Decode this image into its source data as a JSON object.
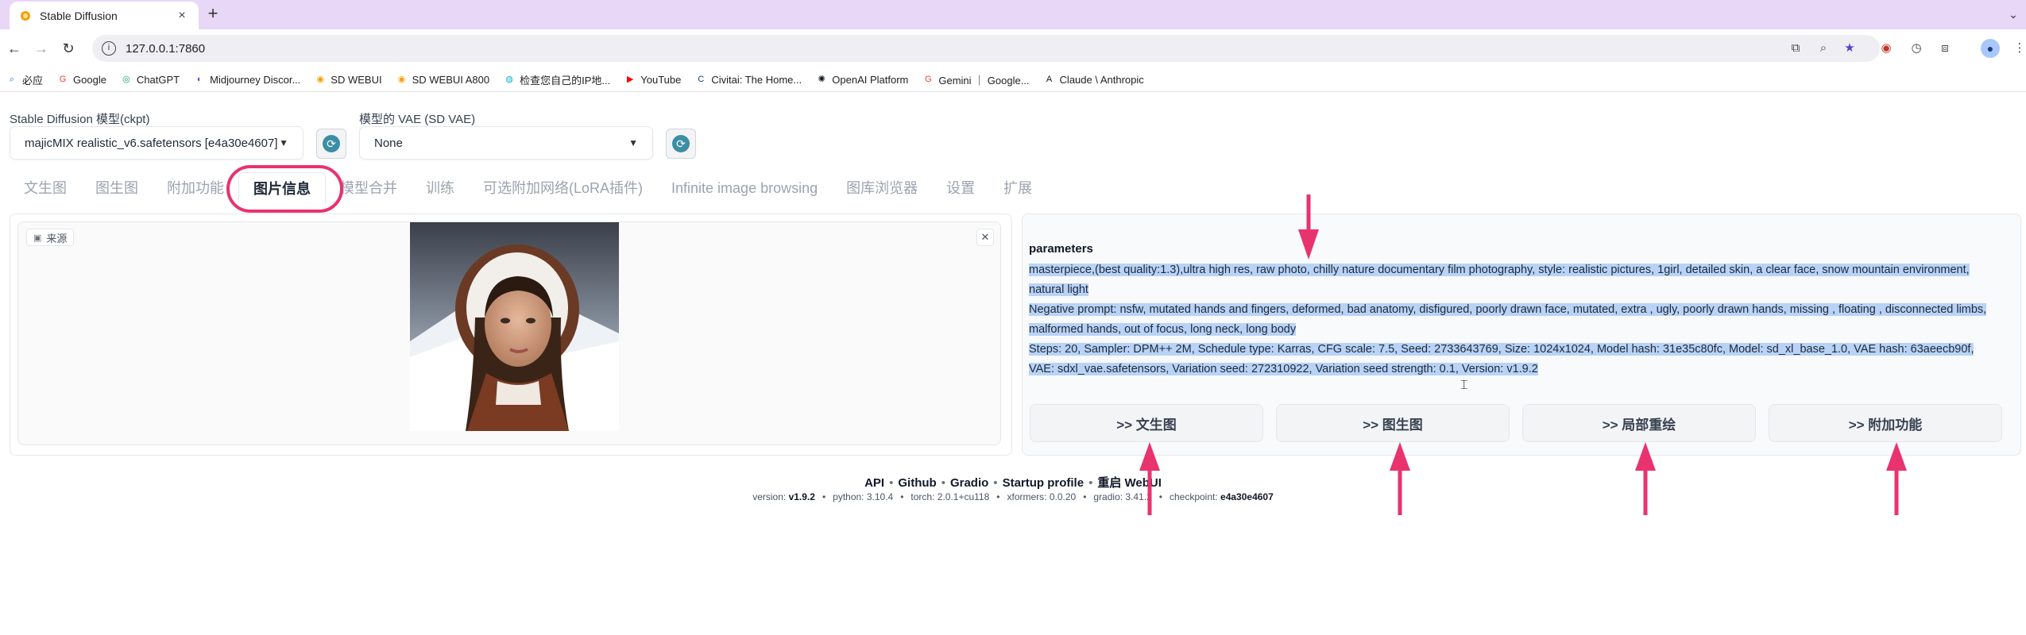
{
  "browser": {
    "tab_title": "Stable Diffusion",
    "tab_close": "×",
    "new_tab": "+",
    "url": "127.0.0.1:7860",
    "bookmarks": [
      {
        "label": "必应",
        "icon": "search-icon"
      },
      {
        "label": "Google",
        "icon": "google-icon"
      },
      {
        "label": "ChatGPT",
        "icon": "chatgpt-icon"
      },
      {
        "label": "Midjourney Discor...",
        "icon": "midjourney-icon"
      },
      {
        "label": "SD WEBUI",
        "icon": "sd-icon"
      },
      {
        "label": "SD WEBUI A800",
        "icon": "sd-icon"
      },
      {
        "label": "检查您自己的IP地...",
        "icon": "ip-icon"
      },
      {
        "label": "YouTube",
        "icon": "youtube-icon"
      },
      {
        "label": "Civitai: The Home...",
        "icon": "civitai-icon"
      },
      {
        "label": "OpenAI Platform",
        "icon": "openai-icon"
      },
      {
        "label": "Gemini ｜ Google...",
        "icon": "google-icon"
      },
      {
        "label": "Claude \\ Anthropic",
        "icon": "anthropic-icon"
      }
    ]
  },
  "models": {
    "ckpt_label": "Stable Diffusion 模型(ckpt)",
    "ckpt_value": "majicMIX realistic_v6.safetensors [e4a30e4607]",
    "vae_label": "模型的 VAE (SD VAE)",
    "vae_value": "None"
  },
  "tabs": [
    "文生图",
    "图生图",
    "附加功能",
    "图片信息",
    "模型合并",
    "训练",
    "可选附加网络(LoRA插件)",
    "Infinite image browsing",
    "图库浏览器",
    "设置",
    "扩展"
  ],
  "active_tab": "图片信息",
  "image_panel": {
    "source_label": "来源",
    "close": "✕"
  },
  "parameters": {
    "title": "parameters",
    "prompt": "masterpiece,(best quality:1.3),ultra high res, raw photo, chilly nature documentary film photography, style: realistic pictures, 1girl, detailed skin, a clear face, snow mountain environment, natural light",
    "negative": "Negative prompt: nsfw, mutated hands and fingers, deformed, bad anatomy, disfigured, poorly drawn face, mutated, extra , ugly, poorly drawn hands, missing , floating , disconnected limbs, malformed hands, out of focus, long neck, long body",
    "settings": "Steps: 20, Sampler: DPM++ 2M, Schedule type: Karras, CFG scale: 7.5, Seed: 2733643769, Size: 1024x1024, Model hash: 31e35c80fc, Model: sd_xl_base_1.0, VAE hash: 63aeecb90f, VAE: sdxl_vae.safetensors, Variation seed: 272310922, Variation seed strength: 0.1, Version: v1.9.2"
  },
  "send_buttons": [
    ">> 文生图",
    ">> 图生图",
    ">> 局部重绘",
    ">> 附加功能"
  ],
  "footer": {
    "links": [
      "API",
      "Github",
      "Gradio",
      "Startup profile",
      "重启 WebUI"
    ],
    "versions": [
      {
        "k": "version: ",
        "v": "v1.9.2"
      },
      {
        "k": "python: 3.10.4",
        "v": ""
      },
      {
        "k": "torch: 2.0.1+cu118",
        "v": ""
      },
      {
        "k": "xformers: 0.0.20",
        "v": ""
      },
      {
        "k": "gradio: 3.41.2",
        "v": ""
      },
      {
        "k": "checkpoint: ",
        "v": "e4a30e4607"
      }
    ]
  },
  "colors": {
    "annotation": "#e8336f",
    "selection": "#b9d3f7",
    "tabstrip": "#e8d7f6"
  }
}
